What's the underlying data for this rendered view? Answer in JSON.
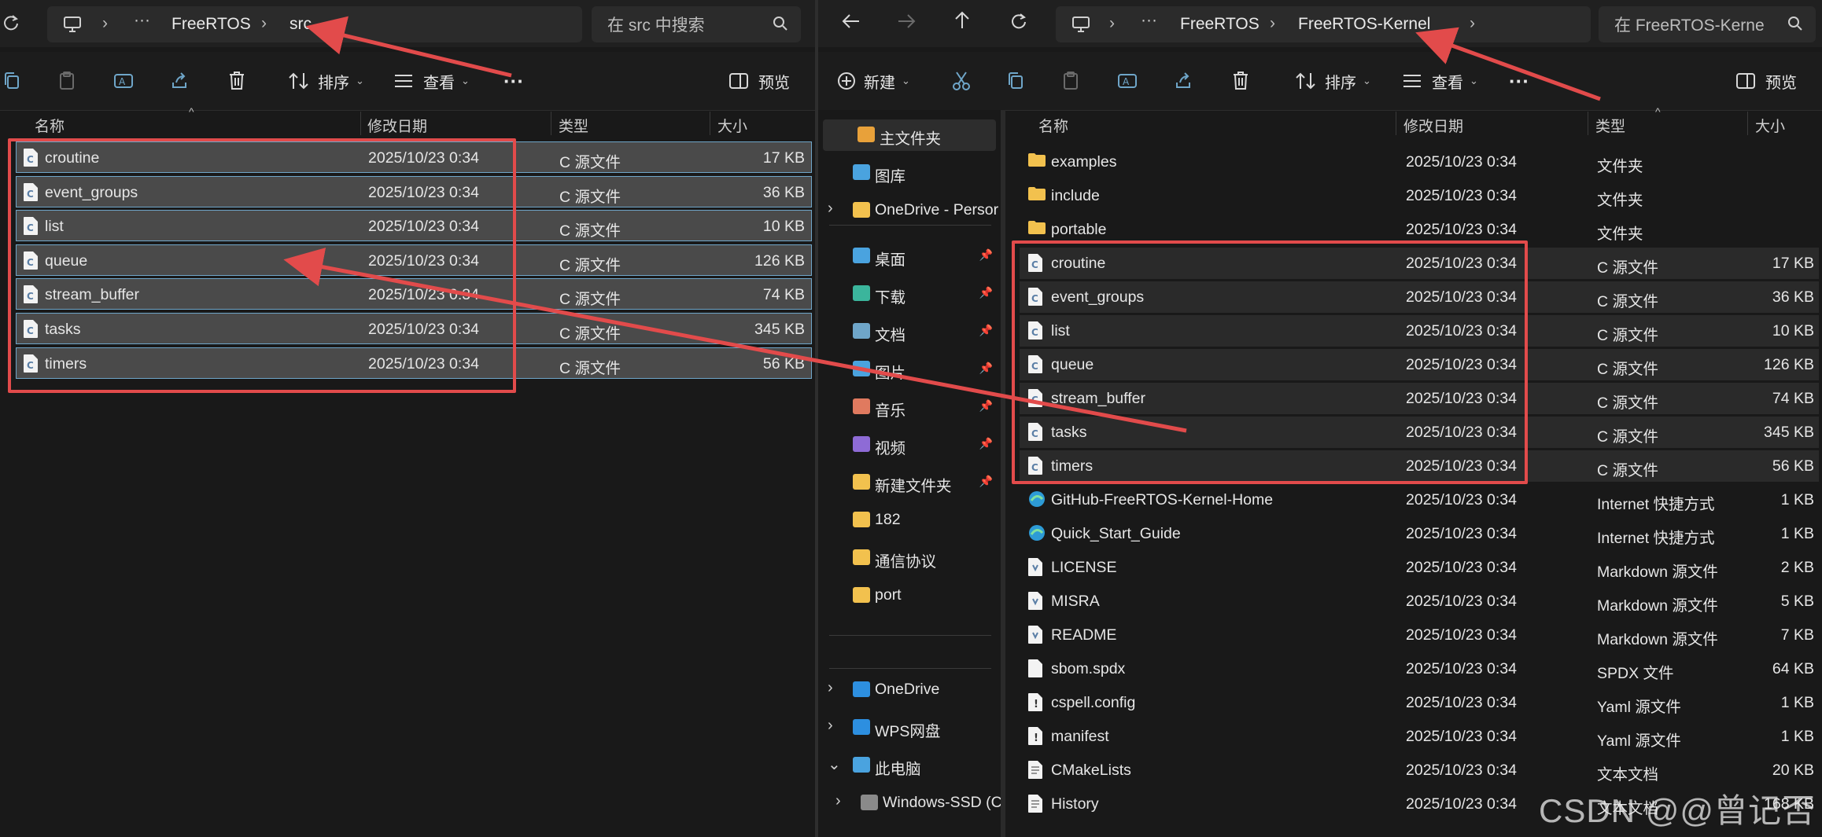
{
  "left": {
    "crumbs": [
      "FreeRTOS",
      "src"
    ],
    "search_placeholder": "在 src 中搜索",
    "toolbar": {
      "sort": "排序",
      "view": "查看",
      "more": "···",
      "preview": "预览"
    },
    "columns": [
      "名称",
      "修改日期",
      "类型",
      "大小"
    ],
    "rows": [
      {
        "name": "croutine",
        "date": "2025/10/23 0:34",
        "type": "C 源文件",
        "size": "17 KB"
      },
      {
        "name": "event_groups",
        "date": "2025/10/23 0:34",
        "type": "C 源文件",
        "size": "36 KB"
      },
      {
        "name": "list",
        "date": "2025/10/23 0:34",
        "type": "C 源文件",
        "size": "10 KB"
      },
      {
        "name": "queue",
        "date": "2025/10/23 0:34",
        "type": "C 源文件",
        "size": "126 KB"
      },
      {
        "name": "stream_buffer",
        "date": "2025/10/23 0:34",
        "type": "C 源文件",
        "size": "74 KB"
      },
      {
        "name": "tasks",
        "date": "2025/10/23 0:34",
        "type": "C 源文件",
        "size": "345 KB"
      },
      {
        "name": "timers",
        "date": "2025/10/23 0:34",
        "type": "C 源文件",
        "size": "56 KB"
      }
    ]
  },
  "right": {
    "crumbs": [
      "FreeRTOS",
      "FreeRTOS-Kernel"
    ],
    "search_placeholder": "在 FreeRTOS-Kerne",
    "toolbar": {
      "new": "新建",
      "sort": "排序",
      "view": "查看",
      "more": "···",
      "preview": "预览"
    },
    "nav": [
      {
        "label": "主文件夹",
        "icon": "home-icon"
      },
      {
        "label": "图库",
        "icon": "gallery-icon"
      },
      {
        "label": "OneDrive - Persor",
        "icon": "folder-icon"
      },
      {
        "label": "桌面",
        "icon": "desktop-icon"
      },
      {
        "label": "下载",
        "icon": "download-icon"
      },
      {
        "label": "文档",
        "icon": "document-icon"
      },
      {
        "label": "图片",
        "icon": "picture-icon"
      },
      {
        "label": "音乐",
        "icon": "music-icon"
      },
      {
        "label": "视频",
        "icon": "video-icon"
      },
      {
        "label": "新建文件夹",
        "icon": "folder-icon"
      },
      {
        "label": "182",
        "icon": "folder-icon"
      },
      {
        "label": "通信协议",
        "icon": "folder-icon"
      },
      {
        "label": "port",
        "icon": "folder-icon"
      },
      {
        "label": "OneDrive",
        "icon": "cloud-icon"
      },
      {
        "label": "WPS网盘",
        "icon": "cloud-icon"
      },
      {
        "label": "此电脑",
        "icon": "computer-icon"
      },
      {
        "label": "Windows-SSD (C",
        "icon": "drive-icon"
      }
    ],
    "columns": [
      "名称",
      "修改日期",
      "类型",
      "大小"
    ],
    "rows": [
      {
        "name": "examples",
        "date": "2025/10/23 0:34",
        "type": "文件夹",
        "size": "",
        "kind": "folder"
      },
      {
        "name": "include",
        "date": "2025/10/23 0:34",
        "type": "文件夹",
        "size": "",
        "kind": "folder"
      },
      {
        "name": "portable",
        "date": "2025/10/23 0:34",
        "type": "文件夹",
        "size": "",
        "kind": "folder"
      },
      {
        "name": "croutine",
        "date": "2025/10/23 0:34",
        "type": "C 源文件",
        "size": "17 KB",
        "kind": "c"
      },
      {
        "name": "event_groups",
        "date": "2025/10/23 0:34",
        "type": "C 源文件",
        "size": "36 KB",
        "kind": "c"
      },
      {
        "name": "list",
        "date": "2025/10/23 0:34",
        "type": "C 源文件",
        "size": "10 KB",
        "kind": "c"
      },
      {
        "name": "queue",
        "date": "2025/10/23 0:34",
        "type": "C 源文件",
        "size": "126 KB",
        "kind": "c"
      },
      {
        "name": "stream_buffer",
        "date": "2025/10/23 0:34",
        "type": "C 源文件",
        "size": "74 KB",
        "kind": "c"
      },
      {
        "name": "tasks",
        "date": "2025/10/23 0:34",
        "type": "C 源文件",
        "size": "345 KB",
        "kind": "c"
      },
      {
        "name": "timers",
        "date": "2025/10/23 0:34",
        "type": "C 源文件",
        "size": "56 KB",
        "kind": "c"
      },
      {
        "name": "GitHub-FreeRTOS-Kernel-Home",
        "date": "2025/10/23 0:34",
        "type": "Internet 快捷方式",
        "size": "1 KB",
        "kind": "url"
      },
      {
        "name": "Quick_Start_Guide",
        "date": "2025/10/23 0:34",
        "type": "Internet 快捷方式",
        "size": "1 KB",
        "kind": "url"
      },
      {
        "name": "LICENSE",
        "date": "2025/10/23 0:34",
        "type": "Markdown 源文件",
        "size": "2 KB",
        "kind": "md"
      },
      {
        "name": "MISRA",
        "date": "2025/10/23 0:34",
        "type": "Markdown 源文件",
        "size": "5 KB",
        "kind": "md"
      },
      {
        "name": "README",
        "date": "2025/10/23 0:34",
        "type": "Markdown 源文件",
        "size": "7 KB",
        "kind": "md"
      },
      {
        "name": "sbom.spdx",
        "date": "2025/10/23 0:34",
        "type": "SPDX 文件",
        "size": "64 KB",
        "kind": "file"
      },
      {
        "name": "cspell.config",
        "date": "2025/10/23 0:34",
        "type": "Yaml 源文件",
        "size": "1 KB",
        "kind": "yaml"
      },
      {
        "name": "manifest",
        "date": "2025/10/23 0:34",
        "type": "Yaml 源文件",
        "size": "1 KB",
        "kind": "yaml"
      },
      {
        "name": "CMakeLists",
        "date": "2025/10/23 0:34",
        "type": "文本文档",
        "size": "20 KB",
        "kind": "txt"
      },
      {
        "name": "History",
        "date": "2025/10/23 0:34",
        "type": "文本文档",
        "size": "168 KB",
        "kind": "txt"
      }
    ]
  },
  "watermark": "CSDN @@曾记否",
  "colors": {
    "annotation": "#e24b4b",
    "folder": "#f2c14e",
    "selection_border": "#6fa6c9"
  }
}
